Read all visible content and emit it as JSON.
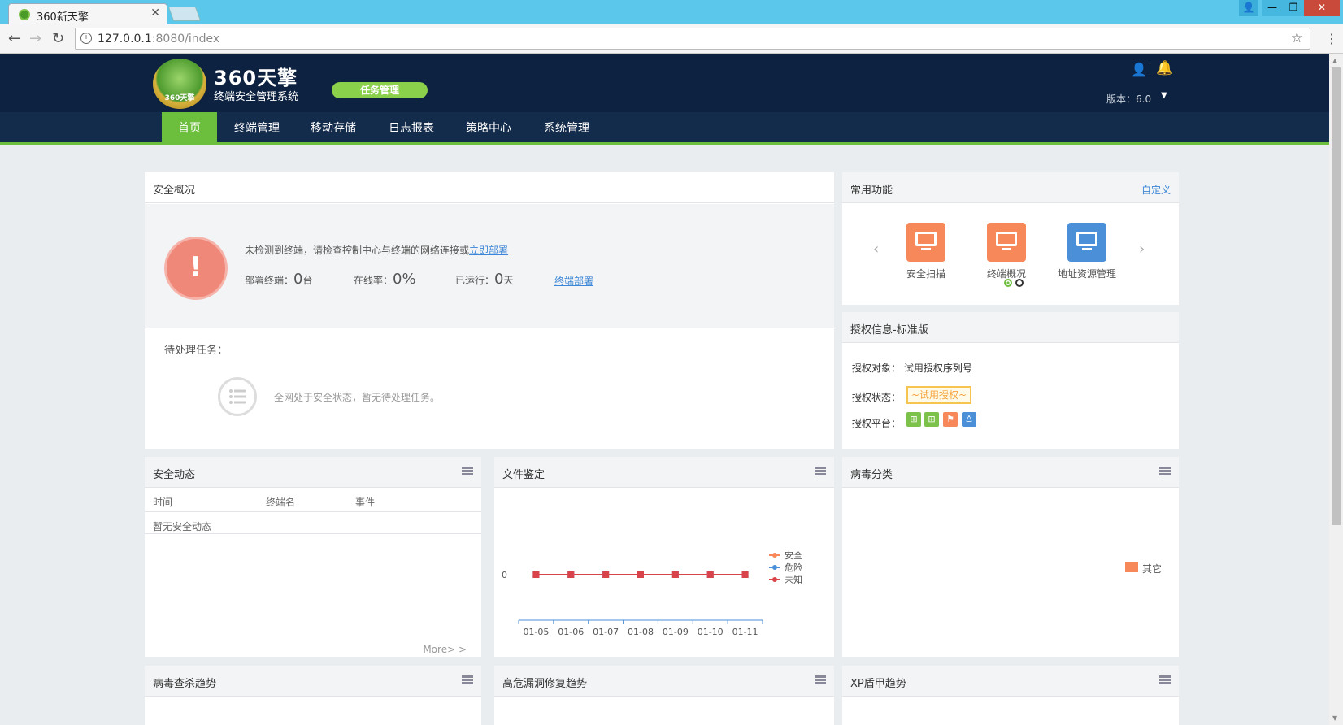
{
  "browser": {
    "tab_title": "360新天擎",
    "url_host": "127.0.0.1",
    "url_rest": ":8080/index"
  },
  "header": {
    "logo_badge_text": "360天擎",
    "logo_title": "360天擎",
    "logo_subtitle": "终端安全管理系统",
    "task_button": "任务管理",
    "version_label": "版本：6.0"
  },
  "nav": {
    "items": [
      "首页",
      "终端管理",
      "移动存储",
      "日志报表",
      "策略中心",
      "系统管理"
    ],
    "active_index": 0
  },
  "overview": {
    "title": "安全概况",
    "alert_symbol": "!",
    "message": "未检测到终端，请检查控制中心与终端的网络连接或",
    "deploy_now_link": "立即部署",
    "deployed_label": "部署终端：",
    "deployed_value": "0",
    "deployed_unit": "台",
    "online_label": "在线率：",
    "online_value": "0%",
    "running_label": "已运行：",
    "running_value": "0",
    "running_unit": "天",
    "deploy_link": "终端部署",
    "pending_title": "待处理任务：",
    "pending_message": "全网处于安全状态，暂无待处理任务。"
  },
  "common_functions": {
    "title": "常用功能",
    "customize_link": "自定义",
    "items": [
      {
        "label": "安全扫描",
        "icon": "monitor-scan-icon",
        "color": "#f6885a"
      },
      {
        "label": "终端概况",
        "icon": "monitor-overview-icon",
        "color": "#f6885a"
      },
      {
        "label": "地址资源管理",
        "icon": "monitor-address-icon",
        "color": "#4b8fd8"
      }
    ]
  },
  "license": {
    "title": "授权信息-标准版",
    "object_label": "授权对象：",
    "object_value": "试用授权序列号",
    "status_label": "授权状态：",
    "status_value": "~试用授权~",
    "platform_label": "授权平台：",
    "platforms": [
      {
        "icon": "windows-icon",
        "color": "#7cc24a"
      },
      {
        "icon": "windows-server-icon",
        "color": "#7cc24a"
      },
      {
        "icon": "flag-icon",
        "color": "#f6885a"
      },
      {
        "icon": "linux-icon",
        "color": "#4b8fd8"
      }
    ]
  },
  "security_events": {
    "title": "安全动态",
    "columns": [
      "时间",
      "终端名",
      "事件"
    ],
    "empty_text": "暂无安全动态",
    "more_link": "More> >"
  },
  "file_identification": {
    "title": "文件鉴定"
  },
  "virus_category": {
    "title": "病毒分类",
    "legend": [
      "其它"
    ],
    "legend_color": "#f6885a"
  },
  "bottom_panels": {
    "virus_trend": "病毒查杀趋势",
    "vuln_trend": "高危漏洞修复趋势",
    "xp_trend": "XP盾甲趋势"
  },
  "chart_data": {
    "type": "line",
    "categories": [
      "01-05",
      "01-06",
      "01-07",
      "01-08",
      "01-09",
      "01-10",
      "01-11"
    ],
    "series": [
      {
        "name": "安全",
        "color": "#f6885a",
        "values": [
          0,
          0,
          0,
          0,
          0,
          0,
          0
        ]
      },
      {
        "name": "危险",
        "color": "#4b8fd8",
        "values": [
          0,
          0,
          0,
          0,
          0,
          0,
          0
        ]
      },
      {
        "name": "未知",
        "color": "#d9444a",
        "values": [
          0,
          0,
          0,
          0,
          0,
          0,
          0
        ]
      }
    ],
    "y_tick_labels": [
      "0"
    ],
    "ylim": [
      0,
      1
    ],
    "legend_position": "right",
    "grid": false
  }
}
